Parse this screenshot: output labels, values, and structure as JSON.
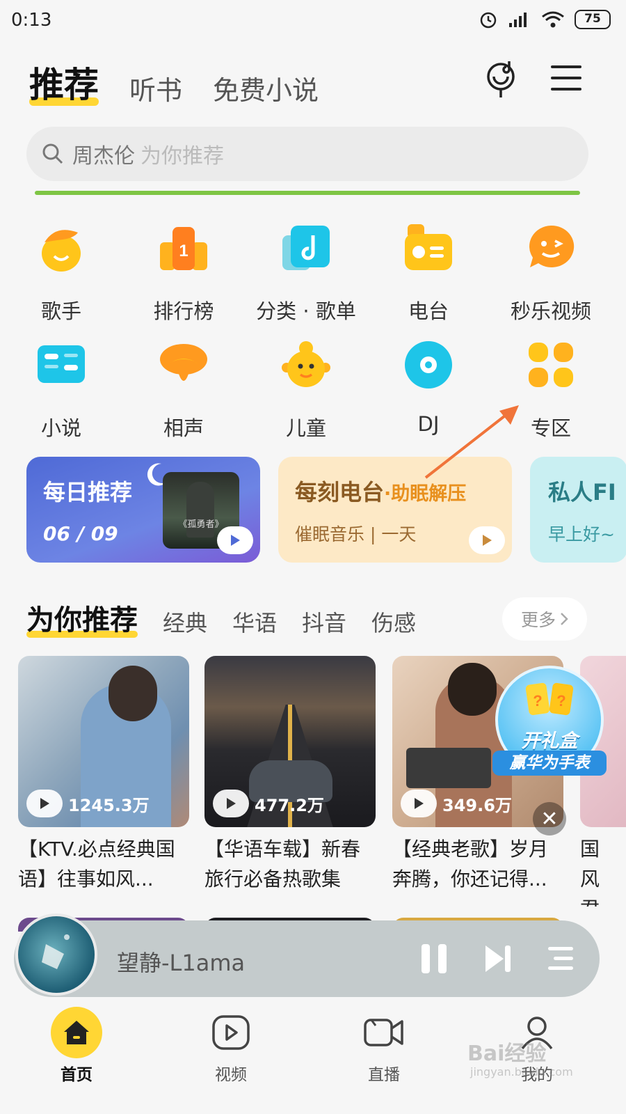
{
  "status_bar": {
    "time": "0:13",
    "battery": "75"
  },
  "top_tabs": [
    {
      "label": "推荐",
      "active": true
    },
    {
      "label": "听书",
      "active": false
    },
    {
      "label": "免费小说",
      "active": false
    }
  ],
  "search": {
    "keyword": "周杰伦",
    "hint": "为你推荐"
  },
  "grid": [
    {
      "label": "歌手",
      "icon": "singer-icon"
    },
    {
      "label": "排行榜",
      "icon": "chart-rank-icon"
    },
    {
      "label": "分类 · 歌单",
      "icon": "music-note-icon"
    },
    {
      "label": "电台",
      "icon": "radio-icon"
    },
    {
      "label": "秒乐视频",
      "icon": "chat-face-icon"
    },
    {
      "label": "小说",
      "icon": "book-icon"
    },
    {
      "label": "相声",
      "icon": "crosstalk-icon"
    },
    {
      "label": "儿童",
      "icon": "child-face-icon"
    },
    {
      "label": "DJ",
      "icon": "disc-icon"
    },
    {
      "label": "专区",
      "icon": "grid-zone-icon"
    }
  ],
  "cards": {
    "daily": {
      "title": "每日推荐",
      "date": "06 / 09",
      "cover_text": "《孤勇者》"
    },
    "radio": {
      "title": "每刻电台",
      "title_suffix": "·助眠解压",
      "subtitle": "催眠音乐 | 一天"
    },
    "fm": {
      "title": "私人FI",
      "subtitle": "早上好~"
    }
  },
  "recommend": {
    "tabs": [
      {
        "label": "为你推荐",
        "active": true
      },
      {
        "label": "经典",
        "active": false
      },
      {
        "label": "华语",
        "active": false
      },
      {
        "label": "抖音",
        "active": false
      },
      {
        "label": "伤感",
        "active": false
      }
    ],
    "more_label": "更多",
    "playlists": [
      {
        "plays": "1245.3万",
        "title": "【KTV.必点经典国语】往事如风..."
      },
      {
        "plays": "477.2万",
        "title": "【华语车载】新春旅行必备热歌集"
      },
      {
        "plays": "349.6万",
        "title": "【经典老歌】岁月奔腾，你还记得..."
      },
      {
        "plays": "",
        "title": "国风君一"
      }
    ]
  },
  "gift_badge": {
    "line1": "开礼盒",
    "line2": "赢华为手表"
  },
  "player": {
    "track": "望静-L1ama"
  },
  "bottom_nav": [
    {
      "label": "首页",
      "icon": "home-icon",
      "active": true
    },
    {
      "label": "视频",
      "icon": "video-play-icon",
      "active": false
    },
    {
      "label": "直播",
      "icon": "live-camera-icon",
      "active": false
    },
    {
      "label": "我的",
      "icon": "profile-icon",
      "active": false
    }
  ],
  "watermark": {
    "text": "Bai经验",
    "sub": "jingyan.baidu.com"
  },
  "colors": {
    "accent_yellow": "#ffd634",
    "green_line": "#7ec544",
    "arrow": "#f0743a"
  }
}
